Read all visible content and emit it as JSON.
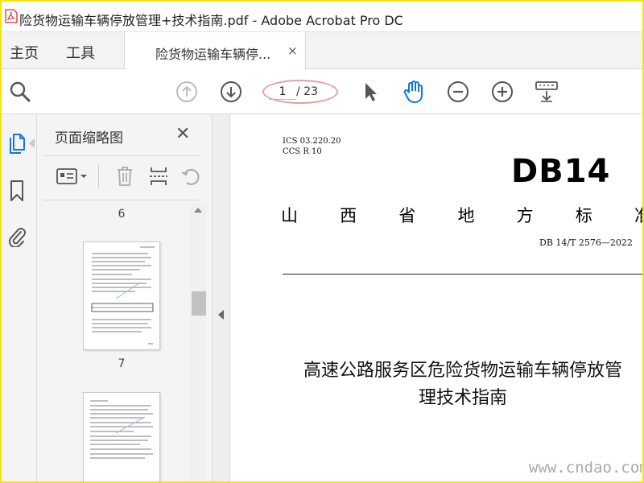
{
  "window": {
    "title": "险货物运输车辆停放管理+技术指南.pdf - Adobe Acrobat Pro DC"
  },
  "tabs": {
    "home": "主页",
    "tools": "工具",
    "document": "险货物运输车辆停...",
    "close": "×"
  },
  "toolbar": {
    "current_page": "1",
    "total_pages": "/ 23",
    "icons": [
      "search-icon",
      "prev-page-icon",
      "next-page-icon",
      "select-arrow-icon",
      "hand-tool-icon",
      "zoom-out-icon",
      "zoom-in-icon",
      "keyboard-icon"
    ]
  },
  "sidebar": {
    "title": "页面缩略图",
    "close": "✕",
    "rail_icons": [
      "pages-icon",
      "bookmark-icon",
      "attachment-icon"
    ],
    "thumbnails": [
      {
        "page": "6"
      },
      {
        "page": "7"
      }
    ]
  },
  "document": {
    "ics": "ICS   03.220.20",
    "ccs": "CCS  R 10",
    "logo": "DB14",
    "standard_type": [
      "山",
      "西",
      "省",
      "地",
      "方",
      "标",
      "准"
    ],
    "standard_number": "DB 14/T  2576—2022",
    "title_line1": "高速公路服务区危险货物运输车辆停放管",
    "title_line2": "理技术指南"
  },
  "watermark": "www.cndao.com",
  "colors": {
    "accent_blue": "#1473e6",
    "frame_yellow": "#f3e600",
    "acrobat_red": "#e0302a",
    "highlight": "#e8a0a0"
  }
}
